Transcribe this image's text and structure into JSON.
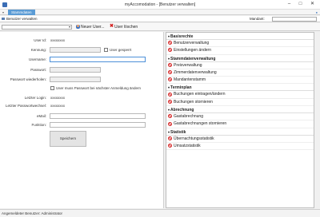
{
  "window": {
    "title": "myAccomodation - [Benutzer verwalten]"
  },
  "ribbon": {
    "tab_label": "Stammdaten"
  },
  "document": {
    "tab_label": "Benutzer verwalten",
    "mandant_label": "Mandant:"
  },
  "toolbar": {
    "new_user_label": "Neuer User...",
    "delete_user_label": "User löschen"
  },
  "form": {
    "userid_label": "User Id:",
    "userid_value": "xxxxxxxx",
    "kennung_label": "Kennung:",
    "locked_label": "User gesperrt",
    "username_label": "Username:",
    "password_label": "Passwort:",
    "password_repeat_label": "Passwort wiederholen:",
    "must_change_label": "User muss Passwort bei nächster Anmeldung ändern",
    "last_login_label": "Letzter Login:",
    "last_login_value": "xxxxxxxx",
    "last_pw_change_label": "Letzter Passwortwechsel:",
    "last_pw_change_value": "xxxxxxxx",
    "email_label": "eMail:",
    "function_label": "Funktion:",
    "save_label": "Speichern"
  },
  "rights": {
    "sections": [
      {
        "title": "Basisrechte",
        "items": [
          "Benutzerverwaltung",
          "Einstellungen ändern"
        ]
      },
      {
        "title": "Stammdatenverwaltung",
        "items": [
          "Preisverwaltung",
          "Zimmerdatenverwaltung",
          "Mandantenstamm"
        ]
      },
      {
        "title": "Terminplan",
        "items": [
          "Buchungen eintragen/ändern",
          "Buchungen stornieren"
        ]
      },
      {
        "title": "Abrechnung",
        "items": [
          "Gastabrechnung",
          "Gastabrechnungen stornieren"
        ]
      },
      {
        "title": "Statistik",
        "items": [
          "Übernachtungsstatistik",
          "Umsatzstatistik"
        ]
      }
    ]
  },
  "status": {
    "text": "Angemeldeter Benutzer: Administrator"
  },
  "icons": {
    "new_user": "user-icon",
    "delete_user": "red-x-icon",
    "right_item": "disabled-circle-icon"
  },
  "colors": {
    "ribbon_tab": "#5a9bd5",
    "deny_icon": "#d42020"
  }
}
